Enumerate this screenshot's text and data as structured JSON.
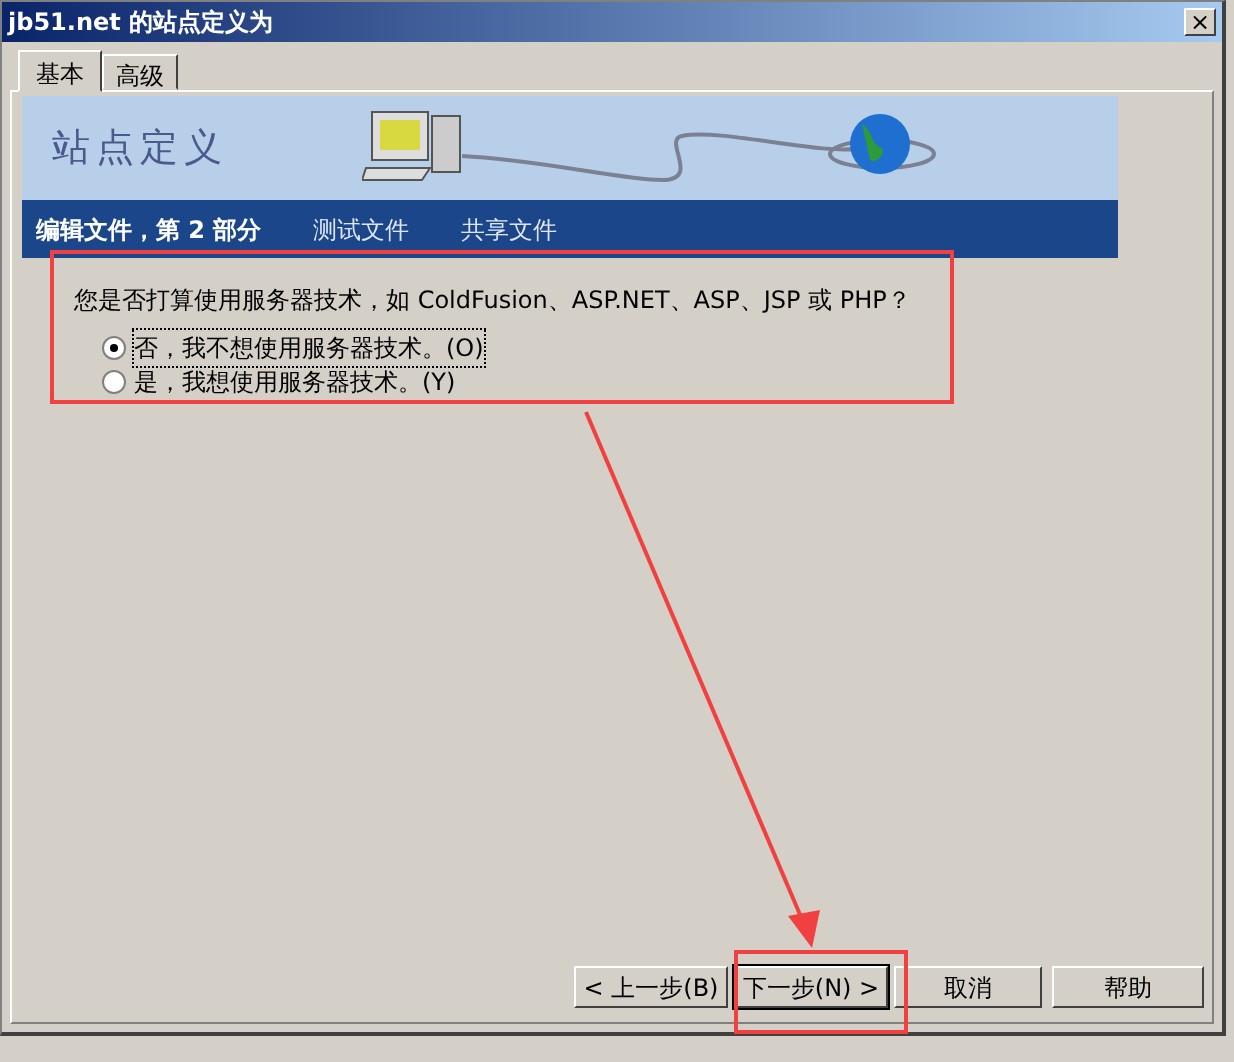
{
  "window": {
    "title": "jb51.net 的站点定义为",
    "close": "×"
  },
  "tabs": [
    {
      "label": "基本",
      "selected": true
    },
    {
      "label": "高级",
      "selected": false
    }
  ],
  "banner": {
    "title": "站点定义"
  },
  "steps": [
    {
      "label": "编辑文件，第 2 部分",
      "selected": true
    },
    {
      "label": "测试文件",
      "selected": false
    },
    {
      "label": "共享文件",
      "selected": false
    }
  ],
  "question": "您是否打算使用服务器技术，如 ColdFusion、ASP.NET、ASP、JSP 或 PHP？",
  "options": [
    {
      "label": "否，我不想使用服务器技术。(O)",
      "selected": true
    },
    {
      "label": "是，我想使用服务器技术。(Y)",
      "selected": false
    }
  ],
  "buttons": [
    {
      "label": "< 上一步(B)",
      "default": false
    },
    {
      "label": "下一步(N) >",
      "default": true
    },
    {
      "label": "取消",
      "default": false
    },
    {
      "label": "帮助",
      "default": false
    }
  ],
  "annotations": {
    "question_box": true,
    "next_button_box": true,
    "arrow": true
  }
}
